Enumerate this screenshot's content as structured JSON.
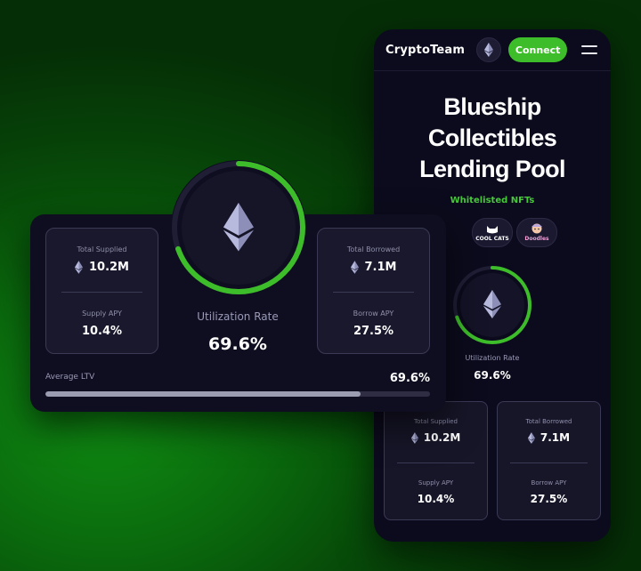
{
  "colors": {
    "accent": "#3dbd2a",
    "panel": "#0f0e20",
    "card": "#19182c",
    "border": "#3a3a55",
    "muted": "#8f8fab"
  },
  "mobile": {
    "brand": "CryptoTeam",
    "network_icon": "ethereum-icon",
    "connect_label": "Connect",
    "menu_icon": "hamburger-menu-icon",
    "title_lines": [
      "Blueship",
      "Collectibles",
      "Lending Pool"
    ],
    "whitelist_label": "Whitelisted NFTs",
    "nfts": [
      {
        "icon": "nft-collection-icon"
      },
      {
        "name": "COOL CATS"
      },
      {
        "name": "Doodles"
      }
    ],
    "utilization_label": "Utilization Rate",
    "utilization_value": "69.6%",
    "utilization_fraction": 0.696,
    "supplied": {
      "label": "Total Supplied",
      "value": "10.2M",
      "apy_label": "Supply APY",
      "apy": "10.4%"
    },
    "borrowed": {
      "label": "Total Borrowed",
      "value": "7.1M",
      "apy_label": "Borrow APY",
      "apy": "27.5%"
    }
  },
  "dashboard": {
    "supplied": {
      "label": "Total Supplied",
      "value": "10.2M",
      "apy_label": "Supply APY",
      "apy": "10.4%"
    },
    "borrowed": {
      "label": "Total Borrowed",
      "value": "7.1M",
      "apy_label": "Borrow APY",
      "apy": "27.5%"
    },
    "utilization_label": "Utilization Rate",
    "utilization_value": "69.6%",
    "utilization_fraction": 0.696,
    "ltv_label": "Average LTV",
    "ltv_value": "69.6%",
    "ltv_fraction": 0.82
  }
}
